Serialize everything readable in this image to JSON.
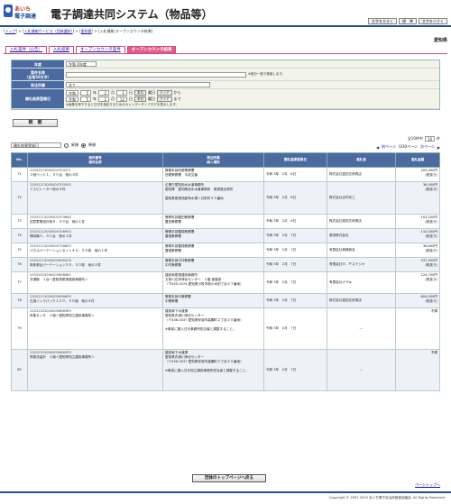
{
  "header": {
    "logo_line1": "あいち",
    "logo_line2": "電子調達",
    "title": "電子調達共同システム（物品等）",
    "buttons": [
      "文字を大きく",
      "標　準",
      "文字を小さく"
    ]
  },
  "breadcrumb": {
    "items": [
      "トップ",
      "入札情報サービス（団体選択）",
      "愛知県"
    ],
    "current": "入札情報:オープンカウンタ結果"
  },
  "prefecture": "愛知県",
  "tabs": [
    "入札案件（公告）",
    "入札結果",
    "オープンカウンタ案件",
    "オープンカウンタ結果"
  ],
  "search": {
    "nendo_label": "年度",
    "nendo_value": "令和 4年度",
    "case_label": "案件名称\n（全角50文字）",
    "case_note": "※部分一致で検索します。",
    "dept_label": "発注所属",
    "dept_value": "全て",
    "date_label": "開札結果登録日",
    "era": "令和",
    "from": {
      "y": "5",
      "m": "2",
      "d": "1"
    },
    "to": {
      "y": "5",
      "m": "2",
      "d": "12"
    },
    "clear": "クリア",
    "from_suffix": "から",
    "to_suffix": "まで",
    "today": "本日",
    "unit_y": "年",
    "unit_m": "月",
    "unit_d": "日",
    "cal": "曜日",
    "date_note": "※画像を押下すると日付を指定するためのカレンダーダイアログを表示します。",
    "button": "検　索"
  },
  "listing": {
    "count_text": "全10件中",
    "per_page": "10",
    "per_page_suffix": "件",
    "sort_select": "開札結果登録日",
    "asc": "昇順",
    "desc": "降順",
    "prev": "前ページ",
    "page_info": "0/30ページ",
    "next": "次ページ"
  },
  "table": {
    "headers": [
      "No.",
      "案件番号\n案件名称",
      "発注所属\n納入場所",
      "開札結果登録日",
      "落札者",
      "落札金額"
    ],
    "rows": [
      {
        "no": "71",
        "id": "23031213000005703371",
        "name": "２段ベッド１，００台　他の４件",
        "dept": "警察本部西尾警察署\n西尾警察署　平成交番",
        "date": "令和 5年　2月　8日",
        "winner": "株式会社富田文房具店",
        "price": "205,000円\n(税抜き)"
      },
      {
        "no": "72",
        "id": "23031213000005703393",
        "name": "アスピレーター他の４件",
        "dept": "企業庁愛知用水水道事務所\n愛知郷　愛知県用水水道事務所　尾張愛出張所\n\n愛知県尾張西部浄水場＞日町町３５番地",
        "date": "令和 5年　2月　8日",
        "winner": "株式会社吉村化工",
        "price": "36,000円\n(税抜き)"
      },
      {
        "no": "73",
        "id": "23031213000005703660",
        "name": "如意蓄電池外他６．００台　他の１件",
        "dept": "警察本部豊田警察署\n豊田警察署",
        "date": "令和 5年　2月　8日",
        "winner": "株式会社富田文房具店",
        "price": "103,200円\n(税抜き)"
      },
      {
        "no": "74",
        "id": "23031213000005708903",
        "name": "掃除機５，００台　他の１件",
        "dept": "警察本部豊橋警察署\n豊橋警察署",
        "date": "令和 5年　2月　7日",
        "winner": "原田株式会社",
        "price": "110,500円\n(税抜き)"
      },
      {
        "no": "75",
        "id": "23031213000005708659",
        "name": "パネルパーテーションセット４０，００枚　他の１件",
        "dept": "警察本部豊橋警察署\n豊橋警察署",
        "date": "令和 5年　2月　7日",
        "winner": "有限会社奥機商会",
        "price": "36,600円\n(税抜き)"
      },
      {
        "no": "76",
        "id": "23031213000005698476",
        "name": "荷床張出パーテーション５５．００枚　他の３件",
        "dept": "警察本部中村警察署\n中村警察署",
        "date": "令和 5年　2月　7日",
        "winner": "有限会社Ｏ．Ｐステジオ",
        "price": "337,900円\n(税抜き)"
      },
      {
        "no": "77",
        "id": "23031923000005698682",
        "name": "洗濯機　１台＜愛知県尾張建設事務所＞",
        "dept": "建設局尾張建設事務所\n五条川左岸浄化センター　１階 渡渡室\n（下455-0374 愛知県小牧市新小木田丁目４７番地）",
        "date": "令和 5年　2月　7日",
        "winner": "有限会社オザキ",
        "price": "224,700円\n(税抜き)"
      },
      {
        "no": "78",
        "id": "23031213000005698699",
        "name": "左換インクパック１２０，００個　他の４件",
        "dept": "警察本部中警察署\n中警察署",
        "date": "令和 5年　2月　7日",
        "winner": "株式会社富田文房具店",
        "price": "804,000円\n(税抜き)"
      },
      {
        "no": "79",
        "id": "23031323000005668989",
        "name": "気象センサ　１個＜愛知県知立建設事務所＞",
        "dept": "建設局下水道課\n愛知県衣浦川浄化センター\n（〒446-0037 愛知県安城市高棚町２丁目２０番地）\n\n※事前に搬入日を事務所担当者と調整すること。",
        "date": "令和 5年　2月　7日",
        "winner": "---",
        "price": "不調"
      },
      {
        "no": "80",
        "id": "23031323000005668993",
        "name": "簡易流量計　１個＜愛知県知立建設事務所＞",
        "dept": "建設局下水道課\n愛知県衣浦川浄化センター\n（〒446-0037 愛知県安城市高棚町２丁目２０番地）\n\n※事前に搬入日を知立建設事務所担当者と調整すること。",
        "date": "令和 5年　2月　7日",
        "winner": "---",
        "price": "不調"
      }
    ]
  },
  "bottom_button": "団体のトップページへ戻る",
  "pagetop": "ページトップへ",
  "footer": "Copyright © 2007-2023 あいち電子自治体推進協議会. All Rights Reserved."
}
